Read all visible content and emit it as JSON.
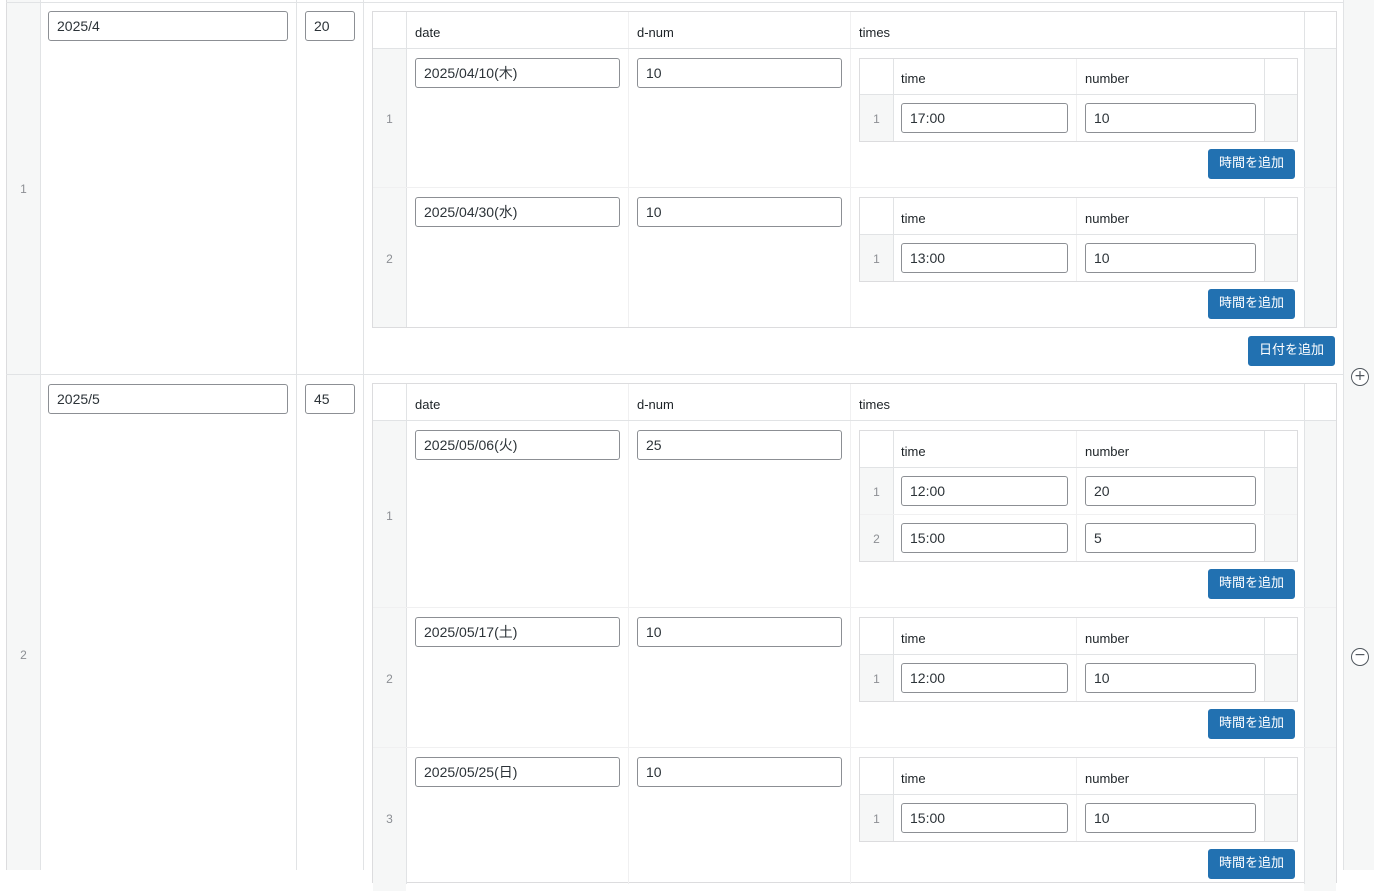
{
  "add_time_label": "時間を追加",
  "add_date_label": "日付を追加",
  "plus_icon": "+",
  "minus_icon": "−",
  "headers": {
    "date": "date",
    "d_num": "d-num",
    "times": "times",
    "time": "time",
    "number": "number"
  },
  "months": [
    {
      "row_num": "1",
      "month": "2025/4",
      "total": "20",
      "dates": [
        {
          "row_num": "1",
          "date": "2025/04/10(木)",
          "d_num": "10",
          "times": [
            {
              "row_num": "1",
              "time": "17:00",
              "number": "10"
            }
          ]
        },
        {
          "row_num": "2",
          "date": "2025/04/30(水)",
          "d_num": "10",
          "times": [
            {
              "row_num": "1",
              "time": "13:00",
              "number": "10"
            }
          ]
        }
      ]
    },
    {
      "row_num": "2",
      "month": "2025/5",
      "total": "45",
      "dates": [
        {
          "row_num": "1",
          "date": "2025/05/06(火)",
          "d_num": "25",
          "times": [
            {
              "row_num": "1",
              "time": "12:00",
              "number": "20"
            },
            {
              "row_num": "2",
              "time": "15:00",
              "number": "5"
            }
          ]
        },
        {
          "row_num": "2",
          "date": "2025/05/17(土)",
          "d_num": "10",
          "times": [
            {
              "row_num": "1",
              "time": "12:00",
              "number": "10"
            }
          ]
        },
        {
          "row_num": "3",
          "date": "2025/05/25(日)",
          "d_num": "10",
          "times": [
            {
              "row_num": "1",
              "time": "15:00",
              "number": "10"
            }
          ]
        }
      ]
    }
  ]
}
